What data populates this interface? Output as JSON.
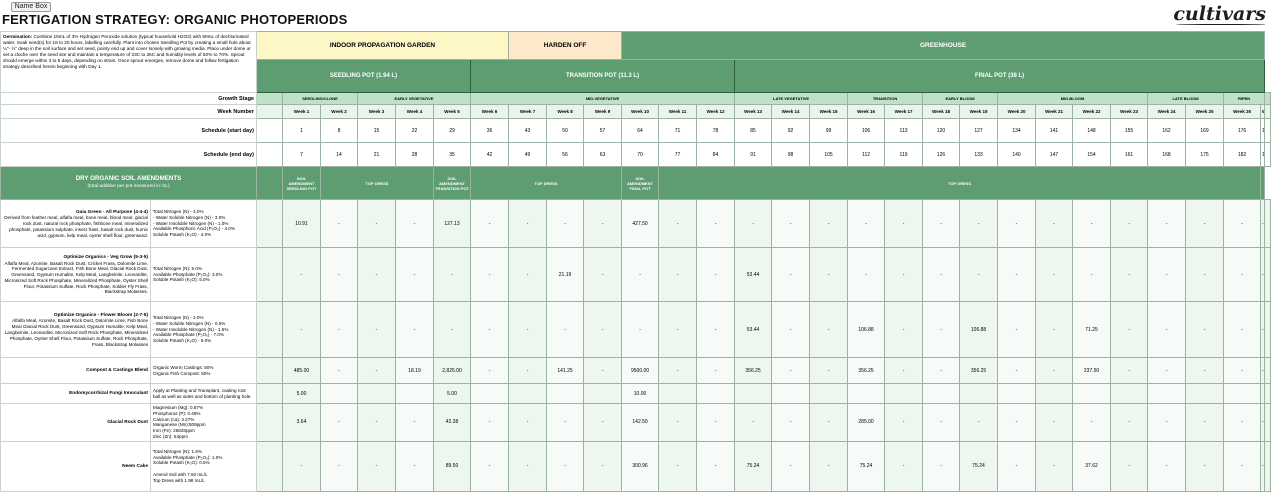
{
  "name_box": "Name Box",
  "title": "FERTIGATION STRATEGY:  ORGANIC PHOTOPERIODS",
  "logo": "cultivars",
  "germination": {
    "label": "Germination:",
    "text": " Combine 15mL of 3% Hydrogen Peroxide solution (typical household H2O2) with 80mL of dechlorinated water. Soak seed(s) for 18 to 20 hours, labelling carefully. Plant into chosen Seedling Pot by creating a small hole about ¼\"- ½\" deep in the soil surface and set seed, pointy end up and cover loosely with growing media. Place under dome or set a cloche over the seed site and maintain a temperature of 23C to 26C and humidity levels of 50% to 70%. Sprout should emerge within 3 to 5 days, depending on strain. Once sprout emerges, remove dome and follow fertigation strategy described herein beginning with Day 1."
  },
  "zones": [
    "INDOOR PROPAGATION GARDEN",
    "HARDEN OFF",
    "GREENHOUSE"
  ],
  "pots": [
    "SEEDLING POT (1.94 L)",
    "TRANSITION POT (11.3 L)",
    "FINAL POT (38 L)"
  ],
  "labels": {
    "stage": "Growth Stage",
    "week": "Week Number",
    "start": "Schedule (start day)",
    "end": "Schedule (end day)"
  },
  "stages": [
    {
      "label": "SEEDLING/CLONE",
      "span": 2
    },
    {
      "label": "EARLY VEGETATIVE",
      "span": 3
    },
    {
      "label": "MID-VEGETATIVE",
      "span": 7
    },
    {
      "label": "LATE VEGETATIVE",
      "span": 3
    },
    {
      "label": "TRANSITION",
      "span": 2
    },
    {
      "label": "EARLY BLOOM",
      "span": 2
    },
    {
      "label": "MID-BLOOM",
      "span": 4
    },
    {
      "label": "LATE BLOOM",
      "span": 2
    },
    {
      "label": "RIPEN",
      "span": 2
    }
  ],
  "weeks": [
    "Week 1",
    "Week 2",
    "Week 3",
    "Week 4",
    "Week 5",
    "Week 6",
    "Week 7",
    "Week 8",
    "Week 9",
    "Week 10",
    "Week 11",
    "Week 12",
    "Week 13",
    "Week 14",
    "Week 15",
    "Week 16",
    "Week 17",
    "Week 18",
    "Week 19",
    "Week 20",
    "Week 21",
    "Week 22",
    "Week 23",
    "Week 24",
    "Week 25",
    "Week 26",
    "Week 27"
  ],
  "start_days": [
    "1",
    "8",
    "15",
    "22",
    "29",
    "36",
    "43",
    "50",
    "57",
    "64",
    "71",
    "78",
    "85",
    "92",
    "99",
    "106",
    "113",
    "120",
    "127",
    "134",
    "141",
    "148",
    "155",
    "162",
    "169",
    "176",
    "183"
  ],
  "end_days": [
    "7",
    "14",
    "21",
    "28",
    "35",
    "42",
    "49",
    "56",
    "63",
    "70",
    "77",
    "84",
    "91",
    "98",
    "105",
    "112",
    "119",
    "126",
    "133",
    "140",
    "147",
    "154",
    "161",
    "168",
    "175",
    "182",
    "189"
  ],
  "amendments_header": {
    "title": "DRY ORGANIC SOIL AMENDMENTS",
    "subtitle": "(total additive per pot measured in mL)",
    "seedling": "SOIL AMENDMENT SEEDLING POT",
    "topdress1": "TOP DRESS",
    "transition": "SOIL AMENDMENT TRANSITION POT",
    "topdress2": "TOP DRESS",
    "final": "SOIL AMENDMENT FINAL POT",
    "topdress3": "TOP DRESS"
  },
  "amendments": [
    {
      "name": "Gaia Green - All Purpose (4-4-4)",
      "ingredients": "Derived from feather meal, alfalfa meal, bone meal, blood meal, glacial rock dust, natural rock phosphate, fishbone meal, mineralized phosphate, potassium sulphate, insect frass, basalt rock dust, humic acid, gypsum, kelp meal, oyster shell flour, greensand.",
      "desc": [
        "Total Nitrogen (N) - 4.0%",
        " - Water Soluble Nitrogen (N) - 3.0%",
        " - Water Insoluble Nitrogen (N) - 1.0%",
        "Available Phosphoric Acid (P₂O₅) - 4.0%",
        "Soluble Potash (K₂O) - 4.0%"
      ],
      "values": [
        "10.91",
        "-",
        "-",
        "-",
        "127.13",
        "-",
        "-",
        "-",
        "-",
        "427.50",
        "-",
        "-",
        "-",
        "-",
        "-",
        "-",
        "-",
        "-",
        "-",
        "-",
        "-",
        "-",
        "-",
        "-",
        "-",
        "-",
        "-"
      ]
    },
    {
      "name": "Optimize Organics - Veg Grow (5-3-5)",
      "ingredients": "Alfalfa Meal, Azomite, Basalt Rock Dust, Cricket Frass, Dolomite Lime, Fermented Sugarcane Extract, Fish Bone Meal, Glacial Rock Dust, Greensand, Gypsum Humalite, Kelp Meal, Langbeinite, Leonardite, Micronized Soft Rock Phosphate, Mineralized Phosphate, Oyster Shell Flour, Potassium Sulfate, Rock Phosphate, Soldier Fly Frass, Blackstrap Molasses.",
      "desc": [
        "Total Nitrogen (N): 5.0%",
        "Available Phosphate (P₂O₅): 3.0%",
        "Soluble Potash (K₂O): 5.0%"
      ],
      "values": [
        "-",
        "-",
        "-",
        "-",
        "-",
        "-",
        "-",
        "21.19",
        "-",
        "-",
        "-",
        "-",
        "53.44",
        "-",
        "-",
        "-",
        "-",
        "-",
        "-",
        "-",
        "-",
        "-",
        "-",
        "-",
        "-",
        "-",
        "-"
      ]
    },
    {
      "name": "Optimize Organics - Flower Bloom (2-7-5)",
      "ingredients": "Alfalfa Meal, Azomite, Basalt Rock Dust, Dolomite Lime, Fish Bone Meal Glacial Rock Dust, Greensand, Gypsum Humalite, Kelp Meal, Langbeinite, Leonardite, Micronized Soft Rock Phosphate, Mineralized Phosphate, Oyster Shell Flour, Potassium Sulfate, Rock Phosphate, Frass, Blackstrap Molasses",
      "desc": [
        "Total Nitrogen (N) - 2.0%",
        " - Water Soluble Nitrogen (N) - 0.5%",
        " - Water Insoluble Nitrogen (N) - 1.5%",
        "Available Phosphate (P₂O₅) - 7.0%",
        "Soluble Potash (K₂O) - 5.0%"
      ],
      "values": [
        "-",
        "-",
        "-",
        "-",
        "-",
        "-",
        "-",
        "-",
        "-",
        "-",
        "-",
        "-",
        "53.44",
        "-",
        "-",
        "106.88",
        "-",
        "-",
        "106.88",
        "-",
        "-",
        "71.25",
        "-",
        "-",
        "-",
        "-",
        "-"
      ]
    },
    {
      "name": "Compost & Castings Blend",
      "ingredients": "",
      "desc": [
        "Organic Worm Castings: 50%",
        "Organic Fish Compost: 50%"
      ],
      "values": [
        "485.00",
        "-",
        "-",
        "18.19",
        "2,825.00",
        "-",
        "-",
        "141.25",
        "-",
        "9500.00",
        "-",
        "-",
        "356.25",
        "-",
        "-",
        "356.25",
        "-",
        "-",
        "356.25",
        "-",
        "-",
        "237.50",
        "-",
        "-",
        "-",
        "-",
        "-"
      ]
    },
    {
      "name": "Endomycorrhizal Fungi Innoculant",
      "ingredients": "",
      "desc": [
        "Apply at Planting and Transplant, coating root ball as well as sides and bottom of planting hole."
      ],
      "values": [
        "5.00",
        "",
        "",
        "",
        "5.00",
        "",
        "",
        "",
        "",
        "10.00",
        "",
        "",
        "",
        "",
        "",
        "",
        "",
        "",
        "",
        "",
        "",
        "",
        "",
        "",
        "",
        "",
        ""
      ]
    },
    {
      "name": "Glacial Rock Dust",
      "ingredients": "",
      "desc": [
        "Magnesium (Mg): 0.87%",
        "Phosphorus (P): 0.49%",
        "Calcium (ca): 3.27%",
        "Manganese (Mn):509ppm",
        "Iron (Fe): 26828ppm",
        "Zinc (Zn): 54ppm"
      ],
      "values": [
        "3.64",
        "-",
        "-",
        "-",
        "42.38",
        "-",
        "-",
        "-",
        "-",
        "142.50",
        "-",
        "-",
        "-",
        "-",
        "-",
        "285.00",
        "-",
        "-",
        "-",
        "-",
        "-",
        "-",
        "-",
        "-",
        "-",
        "-",
        "-"
      ]
    },
    {
      "name": "Neem Cake",
      "ingredients": "",
      "desc": [
        "Total Nitrogen (N): 1.5%",
        "Available Phosphate (P₂O₅): 1.0%",
        "Soluble Potash (K₂O): 0.5%",
        "",
        "Amend Soil with 7.92 mL/L",
        "Top Dress with 1.98 mL/L"
      ],
      "values": [
        "-",
        "-",
        "-",
        "-",
        "89.50",
        "-",
        "-",
        "-",
        "-",
        "300.96",
        "-",
        "-",
        "75.24",
        "-",
        "-",
        "75.24",
        "-",
        "-",
        "75.24",
        "-",
        "-",
        "37.62",
        "-",
        "-",
        "-",
        "-",
        "-"
      ]
    }
  ]
}
